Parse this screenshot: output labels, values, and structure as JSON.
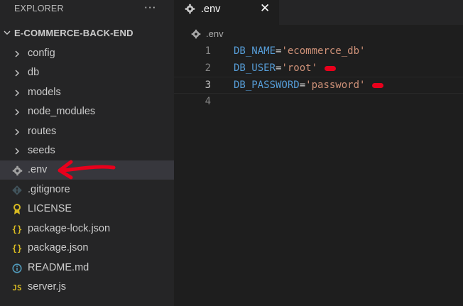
{
  "sidebar": {
    "title": "EXPLORER",
    "more_actions": "···",
    "project": "E-COMMERCE-BACK-END",
    "items": [
      {
        "name": "config",
        "type": "folder",
        "icon": "chevron-right-icon"
      },
      {
        "name": "db",
        "type": "folder",
        "icon": "chevron-right-icon"
      },
      {
        "name": "models",
        "type": "folder",
        "icon": "chevron-right-icon"
      },
      {
        "name": "node_modules",
        "type": "folder",
        "icon": "chevron-right-icon"
      },
      {
        "name": "routes",
        "type": "folder",
        "icon": "chevron-right-icon"
      },
      {
        "name": "seeds",
        "type": "folder",
        "icon": "chevron-right-icon"
      },
      {
        "name": ".env",
        "type": "file",
        "icon": "gear-icon",
        "selected": true
      },
      {
        "name": ".gitignore",
        "type": "file",
        "icon": "git-icon"
      },
      {
        "name": "LICENSE",
        "type": "file",
        "icon": "license-icon"
      },
      {
        "name": "package-lock.json",
        "type": "file",
        "icon": "json-icon",
        "icon_glyph": "{}"
      },
      {
        "name": "package.json",
        "type": "file",
        "icon": "json-icon",
        "icon_glyph": "{}"
      },
      {
        "name": "README.md",
        "type": "file",
        "icon": "info-icon"
      },
      {
        "name": "server.js",
        "type": "file",
        "icon": "js-icon",
        "icon_glyph": "JS"
      }
    ]
  },
  "editor": {
    "tab": {
      "label": ".env",
      "icon": "gear-icon",
      "close": "✕"
    },
    "breadcrumb": {
      "label": ".env",
      "icon": "gear-icon"
    },
    "current_line": 3,
    "lines": [
      {
        "number": "1",
        "key": "DB_NAME",
        "eq": "=",
        "value": "'ecommerce_db'",
        "redacted": false
      },
      {
        "number": "2",
        "key": "DB_USER",
        "eq": "=",
        "value": "'root'",
        "redacted": true
      },
      {
        "number": "3",
        "key": "DB_PASSWORD",
        "eq": "=",
        "value": "'password'",
        "redacted": true
      },
      {
        "number": "4",
        "key": "",
        "eq": "",
        "value": "",
        "redacted": false
      }
    ]
  },
  "colors": {
    "sidebar_bg": "#252526",
    "editor_bg": "#1e1e1e",
    "selection_bg": "#37373d",
    "keyword": "#569cd6",
    "string": "#ce9178",
    "annotation_red": "#e8001c",
    "json_icon": "#d7ba22",
    "js_icon": "#d7ba22",
    "license_icon": "#d7ba22",
    "info_icon": "#519aba",
    "git_icon": "#41535b"
  }
}
